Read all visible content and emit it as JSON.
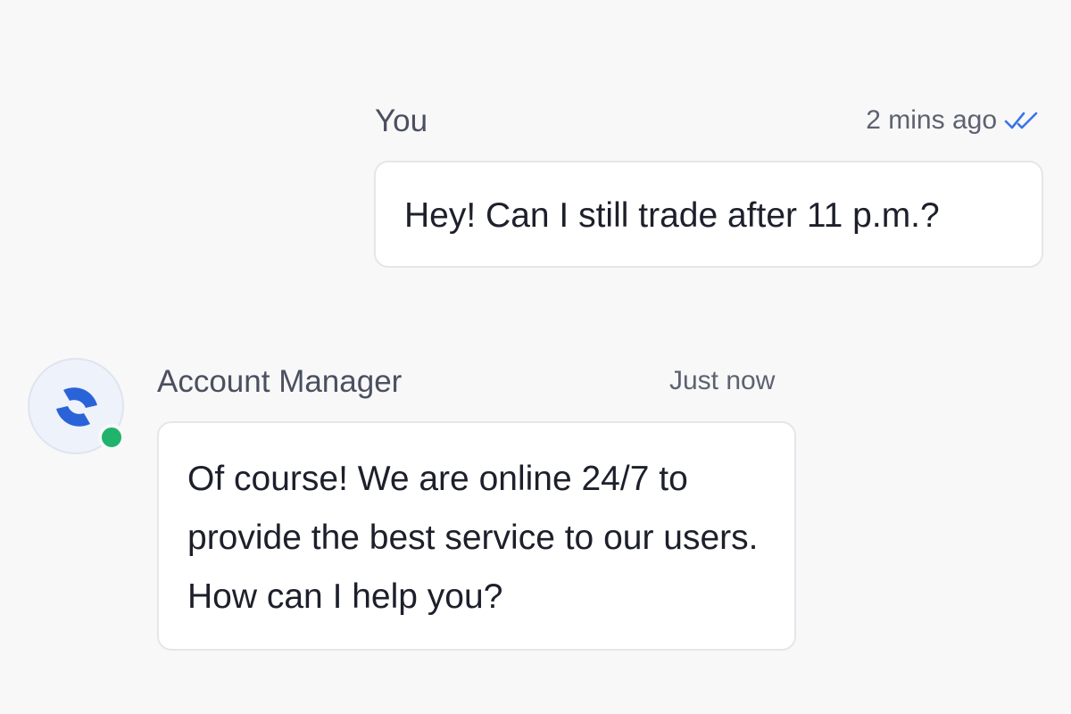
{
  "conversation": {
    "outgoing": {
      "sender": "You",
      "time": "2 mins ago",
      "status_icon": "double-check-icon",
      "status_color": "#3b73e6",
      "text": "Hey! Can I still trade after 11 p.m.?"
    },
    "incoming": {
      "sender": "Account Manager",
      "time": "Just now",
      "avatar_icon": "brand-logo-icon",
      "brand_color": "#2a63d8",
      "online": true,
      "online_color": "#1fb36b",
      "text": "Of course! We are online 24/7 to provide the best service to our users. How can I help you?"
    }
  }
}
